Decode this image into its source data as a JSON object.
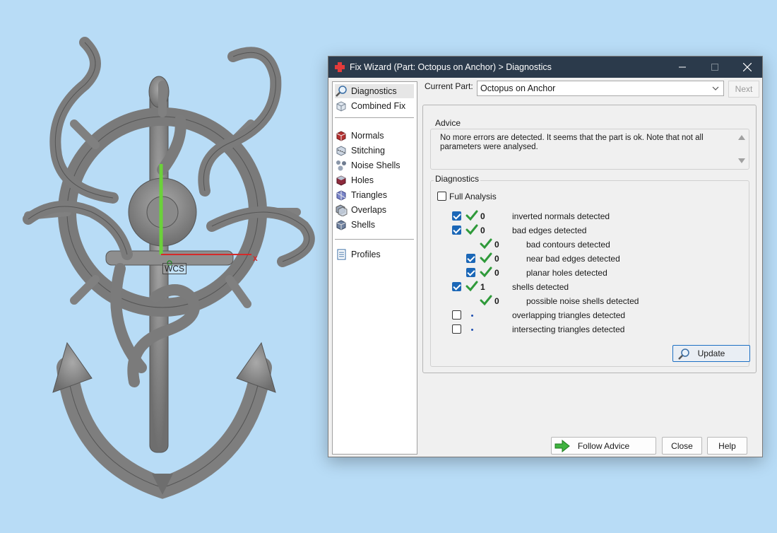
{
  "window": {
    "title": "Fix Wizard (Part: Octopus on Anchor) > Diagnostics"
  },
  "viewport": {
    "wcs_label": "WCS",
    "x_axis_label": "x"
  },
  "nav": {
    "items": [
      {
        "label": "Diagnostics",
        "icon": "magnifier-icon"
      },
      {
        "label": "Combined Fix",
        "icon": "cube-icon"
      },
      {
        "label": "Normals",
        "icon": "normals-cube-icon"
      },
      {
        "label": "Stitching",
        "icon": "stitching-cube-icon"
      },
      {
        "label": "Noise Shells",
        "icon": "noise-shells-icon"
      },
      {
        "label": "Holes",
        "icon": "holes-cube-icon"
      },
      {
        "label": "Triangles",
        "icon": "triangles-cube-icon"
      },
      {
        "label": "Overlaps",
        "icon": "overlaps-cube-icon"
      },
      {
        "label": "Shells",
        "icon": "shells-cube-icon"
      },
      {
        "label": "Profiles",
        "icon": "document-icon"
      }
    ]
  },
  "current_part": {
    "label": "Current Part:",
    "value": "Octopus on Anchor"
  },
  "next_label": "Next",
  "advice": {
    "title": "Advice",
    "text": "No more errors are detected. It seems that the part is ok. Note that not all parameters were analysed."
  },
  "diagnostics": {
    "title": "Diagnostics",
    "full_analysis_label": "Full Analysis",
    "rows": [
      {
        "count": "0",
        "label": "inverted normals detected"
      },
      {
        "count": "0",
        "label": "bad edges detected"
      },
      {
        "count": "0",
        "label": "bad contours detected"
      },
      {
        "count": "0",
        "label": "near bad edges detected"
      },
      {
        "count": "0",
        "label": "planar holes detected"
      },
      {
        "count": "1",
        "label": "shells detected"
      },
      {
        "count": "0",
        "label": "possible noise shells detected"
      },
      {
        "count": "",
        "label": "overlapping triangles detected"
      },
      {
        "count": "",
        "label": "intersecting triangles detected"
      }
    ],
    "update_label": "Update"
  },
  "footer": {
    "follow_advice_label": "Follow Advice",
    "close_label": "Close",
    "help_label": "Help"
  },
  "colors": {
    "background": "#b8dcf6",
    "titlebar": "#2b3a4b",
    "accent": "#1b67b7",
    "ok_check": "#2f9a3a",
    "model": "#8c8c8c"
  }
}
